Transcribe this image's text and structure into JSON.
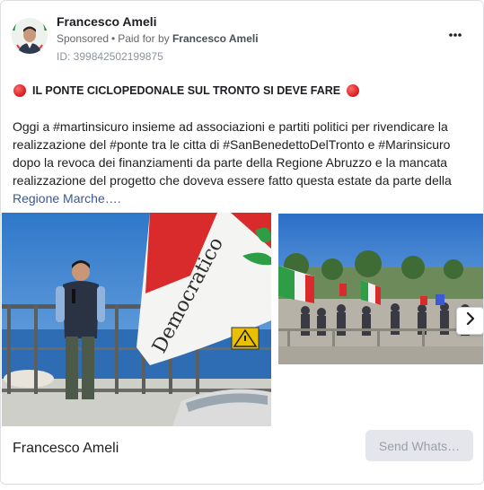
{
  "ad": {
    "advertiser_name": "Francesco Ameli",
    "sponsored_label": "Sponsored",
    "paid_for_prefix": "Paid for by",
    "paid_for_name": "Francesco Ameli",
    "id_text": "ID: 399842502199875",
    "more_menu_icon": "more-horizontal-icon"
  },
  "post": {
    "title": "IL PONTE CICLOPEDONALE SUL TRONTO SI DEVE FARE",
    "title_icon": "red-circle-emoji",
    "body": "Oggi a #martinsicuro insieme ad associazioni e partiti politici per rivendicare la realizzazione del #ponte tra le citta di #SanBenedettoDelTronto e #Marinsicuro dopo la revoca dei finanziamenti da parte della Regione Abruzzo e la mancata realizzazione del progetto che doveva essere fatto questa estate da parte della",
    "body_tail": "Regione Marche….",
    "flag_text": "Democratico"
  },
  "footer": {
    "page_name": "Francesco Ameli",
    "cta_label": "Send Whats…"
  },
  "colors": {
    "link": "#385898",
    "cta_bg": "#e4e6eb",
    "cta_text": "#9aa0a8",
    "secondary_text": "#65676b"
  }
}
